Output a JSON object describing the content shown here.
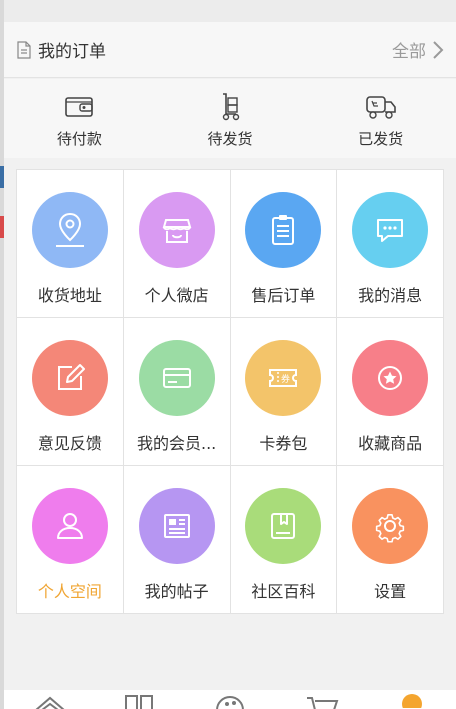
{
  "order_header": {
    "title": "我的订单",
    "all_label": "全部"
  },
  "order_status": [
    {
      "label": "待付款",
      "icon": "wallet-icon"
    },
    {
      "label": "待发货",
      "icon": "hand-truck-icon"
    },
    {
      "label": "已发货",
      "icon": "delivery-truck-icon"
    }
  ],
  "menu_items": [
    {
      "label": "收货地址",
      "icon": "location-pin-icon",
      "color": "#8fb8f5"
    },
    {
      "label": "个人微店",
      "icon": "shop-icon",
      "color": "#d99af2"
    },
    {
      "label": "售后订单",
      "icon": "clipboard-icon",
      "color": "#5aa7f2"
    },
    {
      "label": "我的消息",
      "icon": "chat-bubble-icon",
      "color": "#66cff0"
    },
    {
      "label": "意见反馈",
      "icon": "edit-icon",
      "color": "#f48778"
    },
    {
      "label": "我的会员...",
      "icon": "card-icon",
      "color": "#9bdca4"
    },
    {
      "label": "卡券包",
      "icon": "ticket-icon",
      "color": "#f3c46a"
    },
    {
      "label": "收藏商品",
      "icon": "star-badge-icon",
      "color": "#f77f89"
    },
    {
      "label": "个人空间",
      "icon": "user-icon",
      "color": "#ef7ded",
      "active": true
    },
    {
      "label": "我的帖子",
      "icon": "newspaper-icon",
      "color": "#b696f2"
    },
    {
      "label": "社区百科",
      "icon": "book-icon",
      "color": "#a9dc7a"
    },
    {
      "label": "设置",
      "icon": "gear-icon",
      "color": "#f9925f"
    }
  ],
  "colors": {
    "active_label": "#f0a533",
    "left_marks": [
      "#3a6ea5",
      "#d84a4a"
    ]
  }
}
